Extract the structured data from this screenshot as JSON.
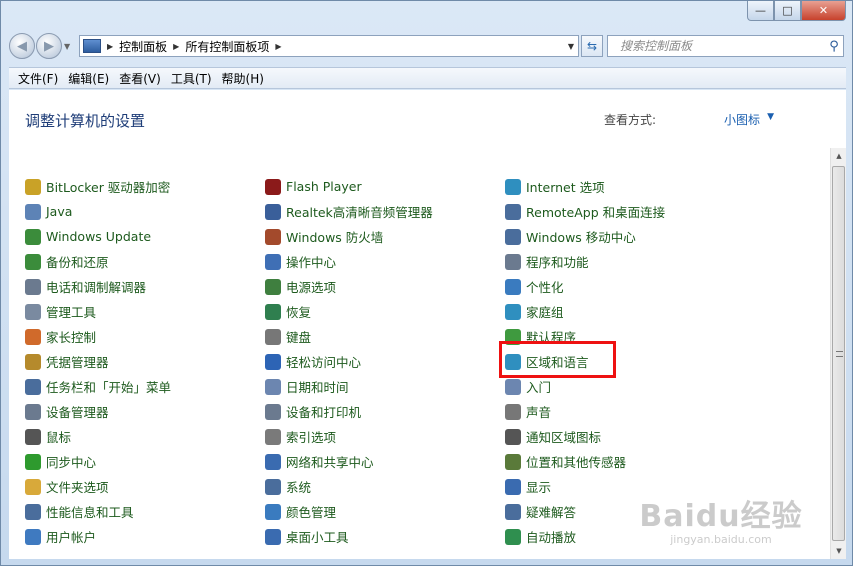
{
  "window": {
    "controls": {
      "minimize": "—",
      "maximize": "□",
      "close": "✕"
    }
  },
  "nav": {
    "back": "◀",
    "forward": "▶",
    "breadcrumbs": [
      "控制面板",
      "所有控制面板项"
    ],
    "search_placeholder": "搜索控制面板"
  },
  "menu": [
    "文件(F)",
    "编辑(E)",
    "查看(V)",
    "工具(T)",
    "帮助(H)"
  ],
  "header": {
    "title": "调整计算机的设置",
    "view_by_label": "查看方式:",
    "view_by_value": "小图标"
  },
  "items": {
    "col1": [
      {
        "label": "BitLocker 驱动器加密",
        "icon": "key-icon",
        "color": "#c9a227"
      },
      {
        "label": "Java",
        "icon": "java-icon",
        "color": "#5d83b6"
      },
      {
        "label": "Windows Update",
        "icon": "windows-update-icon",
        "color": "#3b8c3b"
      },
      {
        "label": "备份和还原",
        "icon": "backup-icon",
        "color": "#3b8c3b"
      },
      {
        "label": "电话和调制解调器",
        "icon": "phone-icon",
        "color": "#6b7a8f"
      },
      {
        "label": "管理工具",
        "icon": "admin-tools-icon",
        "color": "#7a8aa0"
      },
      {
        "label": "家长控制",
        "icon": "parental-icon",
        "color": "#d06a2b"
      },
      {
        "label": "凭据管理器",
        "icon": "credential-icon",
        "color": "#b58a2c"
      },
      {
        "label": "任务栏和「开始」菜单",
        "icon": "taskbar-icon",
        "color": "#4a6d9c"
      },
      {
        "label": "设备管理器",
        "icon": "device-manager-icon",
        "color": "#6b7a8f"
      },
      {
        "label": "鼠标",
        "icon": "mouse-icon",
        "color": "#555555"
      },
      {
        "label": "同步中心",
        "icon": "sync-icon",
        "color": "#2e9a2e"
      },
      {
        "label": "文件夹选项",
        "icon": "folder-icon",
        "color": "#d8a93a"
      },
      {
        "label": "性能信息和工具",
        "icon": "performance-icon",
        "color": "#4a6d9c"
      },
      {
        "label": "用户帐户",
        "icon": "user-icon",
        "color": "#3f7ac0"
      }
    ],
    "col2": [
      {
        "label": "Flash Player",
        "icon": "flash-icon",
        "color": "#8b1a1a"
      },
      {
        "label": "Realtek高清晰音频管理器",
        "icon": "audio-manager-icon",
        "color": "#3a5f9a"
      },
      {
        "label": "Windows 防火墙",
        "icon": "firewall-icon",
        "color": "#a34a2c"
      },
      {
        "label": "操作中心",
        "icon": "flag-icon",
        "color": "#3f6fb5"
      },
      {
        "label": "电源选项",
        "icon": "power-icon",
        "color": "#3f7f3f"
      },
      {
        "label": "恢复",
        "icon": "recovery-icon",
        "color": "#2f7f4f"
      },
      {
        "label": "键盘",
        "icon": "keyboard-icon",
        "color": "#777777"
      },
      {
        "label": "轻松访问中心",
        "icon": "ease-of-access-icon",
        "color": "#2d64b5"
      },
      {
        "label": "日期和时间",
        "icon": "clock-icon",
        "color": "#6c86b0"
      },
      {
        "label": "设备和打印机",
        "icon": "printer-icon",
        "color": "#6b7a8f"
      },
      {
        "label": "索引选项",
        "icon": "index-icon",
        "color": "#7a7a7a"
      },
      {
        "label": "网络和共享中心",
        "icon": "network-icon",
        "color": "#3a6bb0"
      },
      {
        "label": "系统",
        "icon": "system-icon",
        "color": "#4a6d9c"
      },
      {
        "label": "颜色管理",
        "icon": "color-icon",
        "color": "#3a7bbf"
      },
      {
        "label": "桌面小工具",
        "icon": "gadgets-icon",
        "color": "#3a6bb0"
      }
    ],
    "col3": [
      {
        "label": "Internet 选项",
        "icon": "internet-icon",
        "color": "#2f8fbf"
      },
      {
        "label": "RemoteApp 和桌面连接",
        "icon": "remoteapp-icon",
        "color": "#4a6d9c"
      },
      {
        "label": "Windows 移动中心",
        "icon": "mobility-icon",
        "color": "#4a6d9c"
      },
      {
        "label": "程序和功能",
        "icon": "programs-icon",
        "color": "#6b7a8f"
      },
      {
        "label": "个性化",
        "icon": "personalize-icon",
        "color": "#3a7bbf"
      },
      {
        "label": "家庭组",
        "icon": "homegroup-icon",
        "color": "#2f8fbf"
      },
      {
        "label": "默认程序",
        "icon": "default-programs-icon",
        "color": "#3f9a3f"
      },
      {
        "label": "区域和语言",
        "icon": "globe-icon",
        "color": "#2f8fbf"
      },
      {
        "label": "入门",
        "icon": "getting-started-icon",
        "color": "#6c86b0"
      },
      {
        "label": "声音",
        "icon": "speaker-icon",
        "color": "#777777"
      },
      {
        "label": "通知区域图标",
        "icon": "notification-icon",
        "color": "#555555"
      },
      {
        "label": "位置和其他传感器",
        "icon": "sensor-icon",
        "color": "#5a7a3a"
      },
      {
        "label": "显示",
        "icon": "display-icon",
        "color": "#3a6bb0"
      },
      {
        "label": "疑难解答",
        "icon": "troubleshoot-icon",
        "color": "#4a6d9c"
      },
      {
        "label": "自动播放",
        "icon": "autoplay-icon",
        "color": "#2f8f4f"
      }
    ]
  },
  "watermark": {
    "logo": "Baidu经验",
    "url": "jingyan.baidu.com"
  }
}
